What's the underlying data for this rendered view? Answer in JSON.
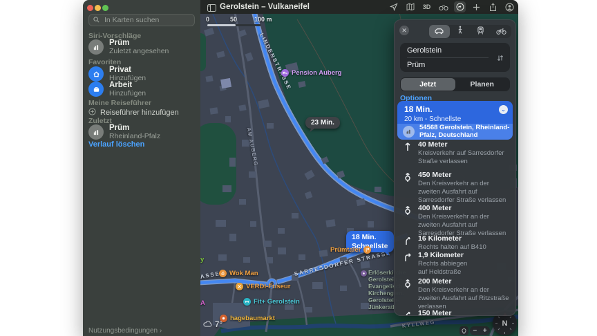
{
  "window": {
    "title": "Gerolstein – Vulkaneifel"
  },
  "toolbar": {
    "label_3d": "3D"
  },
  "sidebar": {
    "search_placeholder": "In Karten suchen",
    "siri_header": "Siri-Vorschläge",
    "siri_item": {
      "title": "Prüm",
      "subtitle": "Zuletzt angesehen"
    },
    "favorites_header": "Favoriten",
    "favorite_home": {
      "title": "Privat",
      "subtitle": "Hinzufügen"
    },
    "favorite_work": {
      "title": "Arbeit",
      "subtitle": "Hinzufügen"
    },
    "guides_header": "Meine Reiseführer",
    "add_guide": "Reiseführer hinzufügen",
    "recents_header": "Zuletzt",
    "recent_item": {
      "title": "Prüm",
      "subtitle": "Rheinland-Pfalz"
    },
    "clear_history": "Verlauf löschen",
    "terms": "Nutzungsbedingungen ›"
  },
  "panel": {
    "origin": "Gerolstein",
    "destination": "Prüm",
    "tab_now": "Jetzt",
    "tab_plan": "Planen",
    "options_label": "Optionen",
    "route": {
      "duration": "18 Min.",
      "summary": "20 km - Schnellste",
      "dest_line1": "54568 Gerolstein, Rheinland-",
      "dest_line2": "Pfalz, Deutschland"
    },
    "steps": [
      {
        "distance": "40 Meter",
        "lines": [
          "Kreisverkehr auf Sarresdorfer",
          "Straße verlassen"
        ]
      },
      {
        "distance": "450 Meter",
        "lines": [
          "Den Kreisverkehr an der",
          "zweiten Ausfahrt auf",
          "Sarresdorfer Straße verlassen"
        ]
      },
      {
        "distance": "400 Meter",
        "lines": [
          "Den Kreisverkehr an der",
          "zweiten Ausfahrt auf",
          "Sarresdorfer Straße verlassen"
        ]
      },
      {
        "distance": "16 Kilometer",
        "lines": [
          "Rechts halten auf B410"
        ]
      },
      {
        "distance": "1,9 Kilometer",
        "lines": [
          "Rechts abbiegen",
          "auf Heldstraße"
        ]
      },
      {
        "distance": "200 Meter",
        "lines": [
          "Den Kreisverkehr an der",
          "zweiten Ausfahrt auf Ritzstraße",
          "verlassen"
        ]
      },
      {
        "distance": "150 Meter",
        "lines": []
      }
    ]
  },
  "map": {
    "scale": {
      "t0": "0",
      "t1": "50",
      "t2": "100 m"
    },
    "streets": {
      "lindenstrasse": "LINDENSTRASSE",
      "am_auberg": "AM AUBERG",
      "sarresdorfer": "SARRESDORFER STRASSE",
      "asse_cut": "ASSE",
      "kyllweg": "KYLLWEG"
    },
    "badge_23": "23 Min.",
    "badge_18_line1": "18 Min.",
    "badge_18_line2": "Schnellste",
    "pois": {
      "pension": "Pension Auberg",
      "pruemtaler": "Prümtaler",
      "wok_man": "Wok Man",
      "verdi": "VERDI-Friseur",
      "fitx": "Fit+ Gerolstein",
      "hagebaumarkt": "hagebaumarkt"
    },
    "church": [
      "Erlöserkirche",
      "Gerolstein –",
      "Evangelische",
      "Kirchengem.",
      "Gerolstein-",
      "Jünkerath"
    ],
    "cut_label_y": "y",
    "cut_label_a": "A",
    "weather": "7°",
    "compass": "N",
    "zoom_minus": "−",
    "zoom_plus": "+"
  },
  "colors": {
    "route_blue": "#4487f2",
    "card_blue": "#2d67de",
    "card_row_blue": "#4a80e8",
    "link_blue": "#4ba3ff",
    "forest_green": "#1d4a41",
    "urban": "#3d4452",
    "building": "#4e586c",
    "poi_orange": "#f0a040",
    "poi_purple": "#cf9df2",
    "poi_teal": "#49c4d2",
    "poi_yellow": "#ecb43c"
  }
}
